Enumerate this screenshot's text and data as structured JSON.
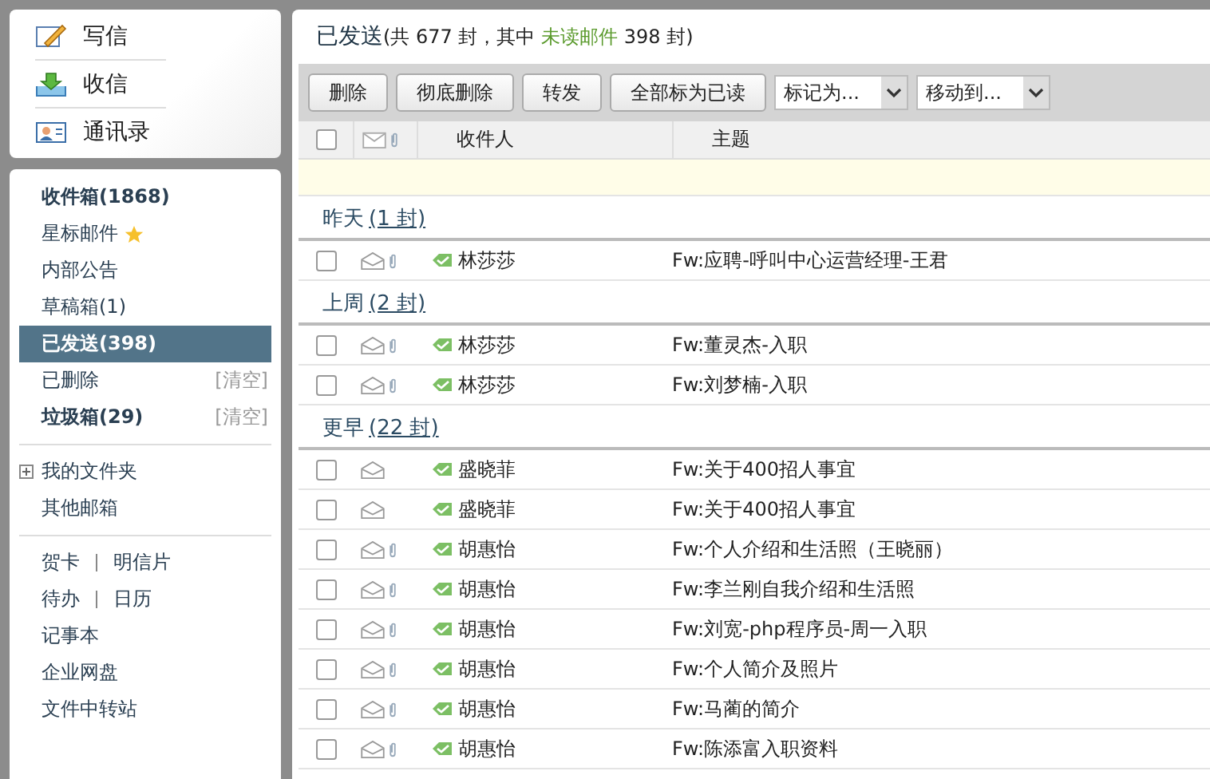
{
  "nav": [
    {
      "kind": "compose",
      "label": "写信"
    },
    {
      "kind": "inbox",
      "label": "收信"
    },
    {
      "kind": "contacts",
      "label": "通讯录"
    }
  ],
  "folders": [
    {
      "label": "收件箱(1868)",
      "bold": true,
      "selected": false,
      "starred": false
    },
    {
      "label": "星标邮件",
      "bold": false,
      "selected": false,
      "starred": true
    },
    {
      "label": "内部公告",
      "bold": false,
      "selected": false,
      "starred": false
    },
    {
      "label": "草稿箱(1)",
      "bold": false,
      "selected": false,
      "starred": false
    },
    {
      "label": "已发送(398)",
      "bold": true,
      "selected": true,
      "starred": false
    },
    {
      "label": "已删除",
      "bold": false,
      "selected": false,
      "starred": false,
      "action": "[清空]"
    },
    {
      "label": "垃圾箱(29)",
      "bold": true,
      "selected": false,
      "starred": false,
      "action": "[清空]"
    }
  ],
  "my_folders": {
    "label": "我的文件夹",
    "expanded": false
  },
  "other_mailboxes": "其他邮箱",
  "tools": [
    [
      "贺卡",
      "明信片"
    ],
    [
      "待办",
      "日历"
    ],
    [
      "记事本"
    ],
    [
      "企业网盘"
    ],
    [
      "文件中转站"
    ]
  ],
  "header": {
    "title": "已发送",
    "summary": [
      {
        "kind": "text",
        "text": "(共 677 封，其中 "
      },
      {
        "kind": "highlight",
        "text": "未读邮件"
      },
      {
        "kind": "text",
        "text": " 398 封)"
      }
    ]
  },
  "toolbar": {
    "buttons": [
      "删除",
      "彻底删除",
      "转发",
      "全部标为已读"
    ],
    "dropdowns": [
      "标记为...",
      "移动到..."
    ]
  },
  "table": {
    "columns": [
      "收件人",
      "主题"
    ],
    "select_all": false,
    "groups": [
      {
        "label": "昨天",
        "count": "(1 封)",
        "rows": [
          {
            "checked": false,
            "attachment": true,
            "to": "林莎莎",
            "subject": "Fw:应聘-呼叫中心运营经理-王君"
          }
        ]
      },
      {
        "label": "上周",
        "count": "(2 封)",
        "rows": [
          {
            "checked": false,
            "attachment": true,
            "to": "林莎莎",
            "subject": "Fw:董灵杰-入职"
          },
          {
            "checked": false,
            "attachment": true,
            "to": "林莎莎",
            "subject": "Fw:刘梦楠-入职"
          }
        ]
      },
      {
        "label": "更早",
        "count": "(22 封)",
        "rows": [
          {
            "checked": false,
            "attachment": false,
            "to": "盛晓菲",
            "subject": "Fw:关于400招人事宜"
          },
          {
            "checked": false,
            "attachment": false,
            "to": "盛晓菲",
            "subject": "Fw:关于400招人事宜"
          },
          {
            "checked": false,
            "attachment": true,
            "to": "胡惠怡",
            "subject": "Fw:个人介绍和生活照（王晓丽）"
          },
          {
            "checked": false,
            "attachment": true,
            "to": "胡惠怡",
            "subject": "Fw:李兰刚自我介绍和生活照"
          },
          {
            "checked": false,
            "attachment": true,
            "to": "胡惠怡",
            "subject": "Fw:刘宽-php程序员-周一入职"
          },
          {
            "checked": false,
            "attachment": true,
            "to": "胡惠怡",
            "subject": "Fw:个人简介及照片"
          },
          {
            "checked": false,
            "attachment": true,
            "to": "胡惠怡",
            "subject": "Fw:马蔺的简介"
          },
          {
            "checked": false,
            "attachment": true,
            "to": "胡惠怡",
            "subject": "Fw:陈添富入职资料"
          }
        ]
      }
    ]
  }
}
